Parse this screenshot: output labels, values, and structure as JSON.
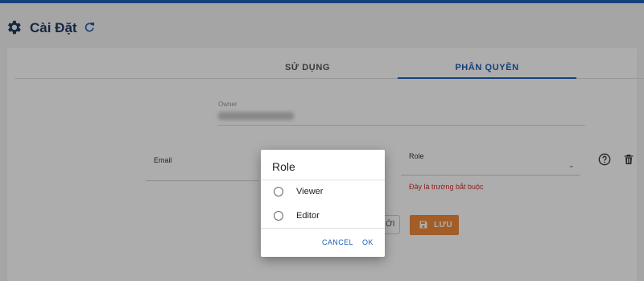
{
  "header": {
    "title": "Cài Đặt"
  },
  "tabs": [
    {
      "label": "SỬ DỤNG"
    },
    {
      "label": "PHÂN QUYỀN"
    }
  ],
  "form": {
    "owner_label": "Owner",
    "email_label": "Email",
    "role_label": "Role",
    "role_error": "Đây là trường bắt buộc",
    "new_button_partial": "ỚI",
    "save_button": "LƯU"
  },
  "dialog": {
    "title": "Role",
    "options": [
      {
        "label": "Viewer"
      },
      {
        "label": "Editor"
      }
    ],
    "cancel": "CANCEL",
    "ok": "OK"
  },
  "icons": [
    "gear-icon",
    "refresh-icon",
    "help-icon",
    "trash-icon",
    "save-icon",
    "chevron-down-icon"
  ],
  "colors": {
    "accent": "#1f5fb4",
    "save": "#f08a3a",
    "error": "#d12f2f"
  }
}
